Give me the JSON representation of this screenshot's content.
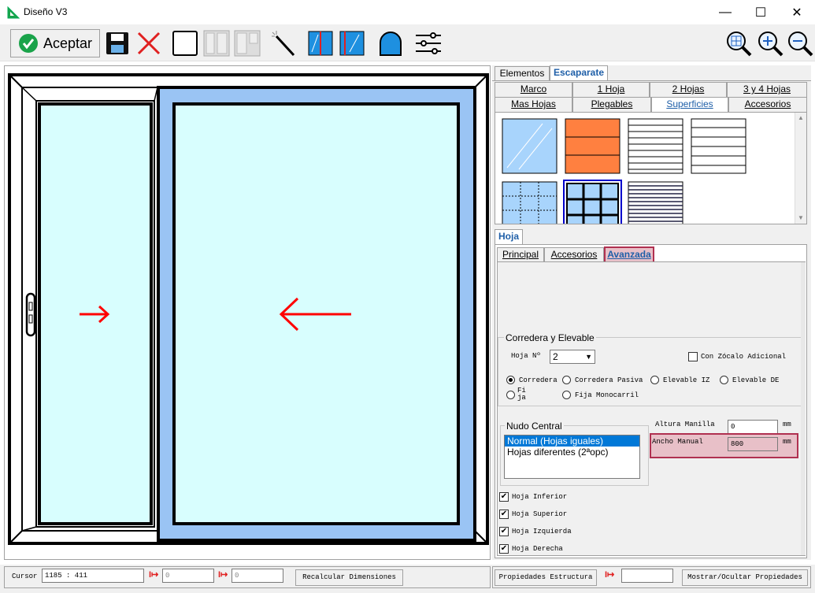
{
  "window": {
    "title": "Diseño V3",
    "minimize": "—",
    "maximize": "☐",
    "close": "✕"
  },
  "toolbar": {
    "accept_label": "Aceptar"
  },
  "colors": {
    "glass": "#d8fefe",
    "leaf": "#9ac4f4",
    "frame": "#000000",
    "arrow": "#ff0000",
    "accent": "#1f5fa8",
    "highlight": "#e8c0c8",
    "highlight_border": "#b03050"
  },
  "top_tabs": [
    "Elementos",
    "Escaparate"
  ],
  "category_tabs_row1": [
    "Marco",
    "1 Hoja",
    "2 Hojas",
    "3 y 4 Hojas"
  ],
  "category_tabs_row2": [
    "Mas Hojas",
    "Plegables",
    "Superficies",
    "Accesorios"
  ],
  "hoja_tab": "Hoja",
  "sub_tabs": [
    "Principal",
    "Accesorios",
    "Avanzada"
  ],
  "corredera": {
    "group_label": "Corredera y Elevable",
    "hoja_label": "Hoja Nº",
    "hoja_value": "2",
    "zocalo_label": "Con Zócalo Adicional",
    "radios": [
      "Corredera",
      "Corredera Pasiva",
      "Elevable IZ",
      "Elevable DE",
      "Fija",
      "Fija Monocarril"
    ],
    "selected": "Corredera"
  },
  "nudo": {
    "group_label": "Nudo Central",
    "options": [
      "Normal (Hojas iguales)",
      "Hojas diferentes (2ªopc)"
    ],
    "selected": "Normal (Hojas iguales)"
  },
  "altura": {
    "label": "Altura Manilla",
    "value": "0",
    "unit": "mm"
  },
  "ancho": {
    "label": "Ancho Manual",
    "value": "800",
    "unit": "mm"
  },
  "checks": [
    "Hoja Inferior",
    "Hoja Superior",
    "Hoja Izquierda",
    "Hoja Derecha"
  ],
  "status": {
    "cursor_label": "Cursor",
    "cursor_value": "1185 : 411",
    "field1": "0",
    "field2": "0",
    "recalc": "Recalcular Dimensiones",
    "props": "Propiedades Estructura",
    "toggle": "Mostrar/Ocultar Propiedades"
  }
}
